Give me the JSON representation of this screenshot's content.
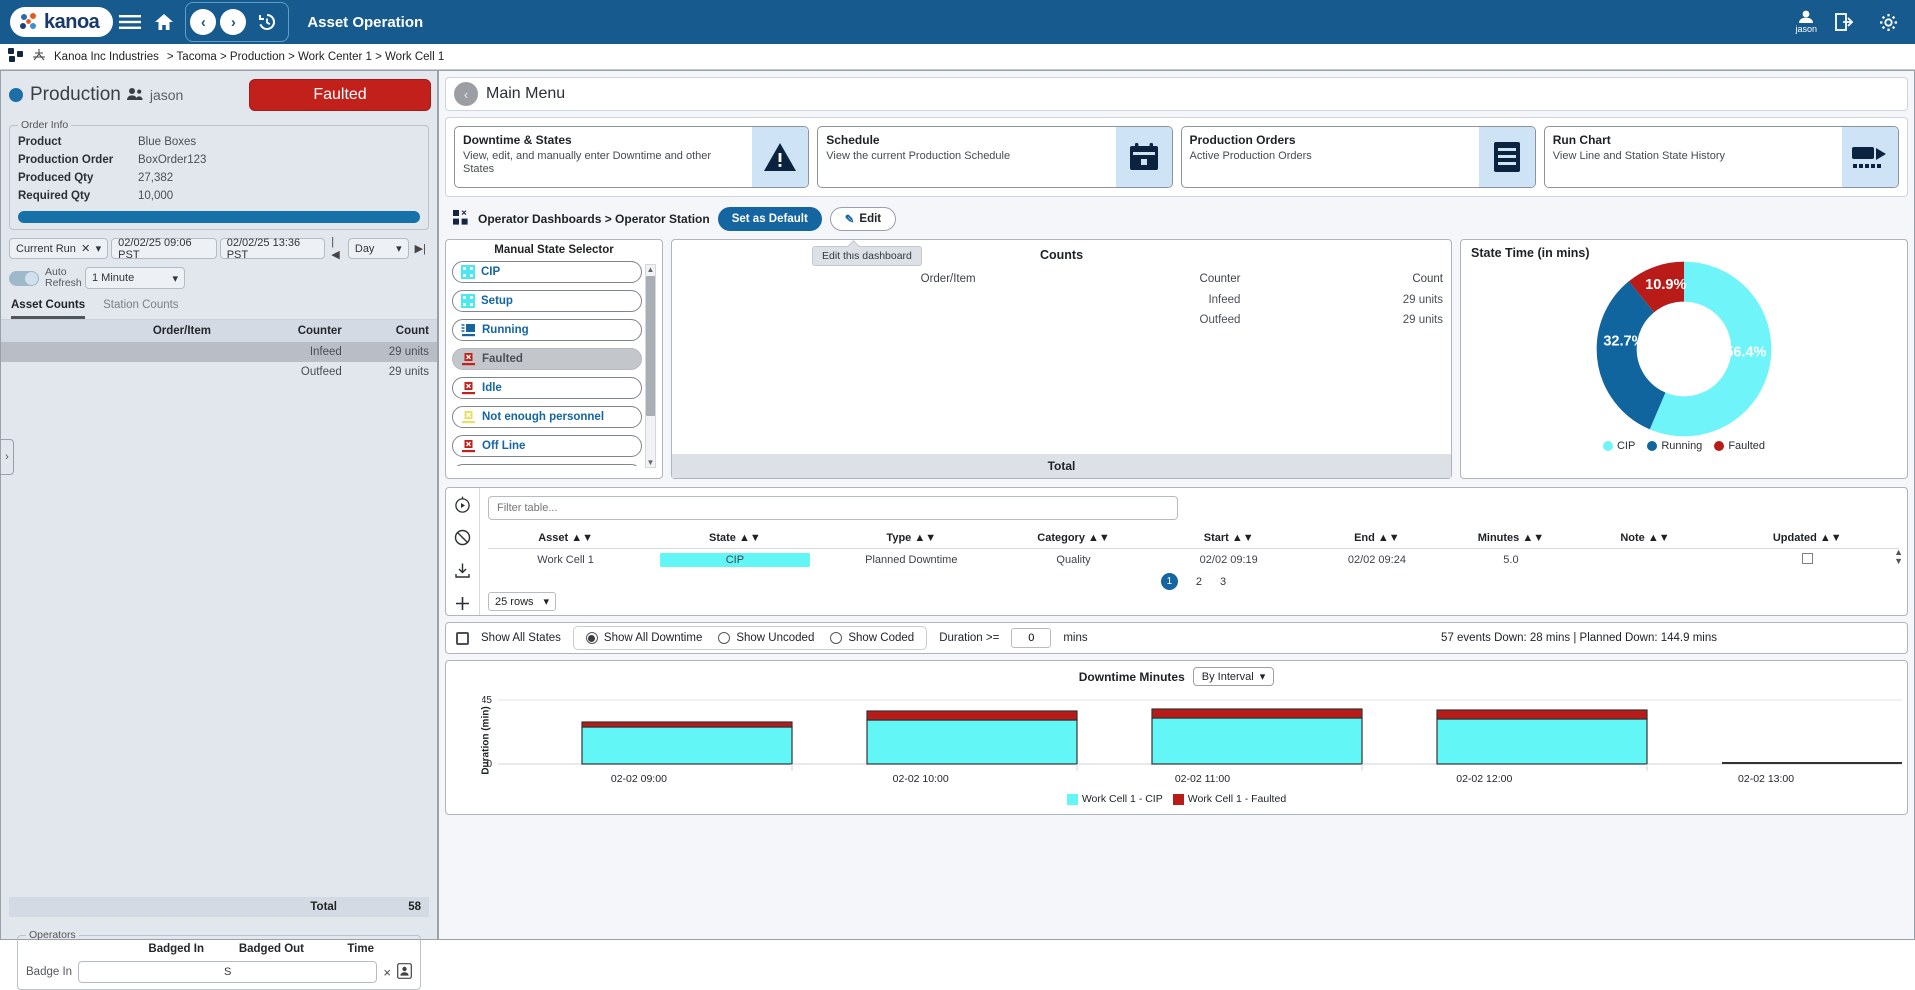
{
  "topbar": {
    "brand": "kanoa",
    "title": "Asset Operation",
    "menu_icon": "hamburger-icon",
    "home_icon": "home-icon",
    "back_icon": "‹",
    "forward_icon": "›",
    "history_icon": "history-icon",
    "user_label": "jason"
  },
  "breadcrumb": {
    "root": "Kanoa Inc Industries",
    "path": "> Tacoma > Production > Work Center 1 > Work Cell 1"
  },
  "left": {
    "header": {
      "title": "Production",
      "user": "jason",
      "status": "Faulted"
    },
    "order_info": {
      "legend": "Order Info",
      "rows": [
        {
          "key": "Product",
          "value": "Blue Boxes"
        },
        {
          "key": "Production Order",
          "value": "BoxOrder123"
        },
        {
          "key": "Produced Qty",
          "value": "27,382"
        },
        {
          "key": "Required Qty",
          "value": "10,000"
        }
      ],
      "progress_pct": 100
    },
    "controls": {
      "run_select": "Current Run",
      "start_time": "02/02/25 09:06 PST",
      "end_time": "02/02/25 13:36 PST",
      "prev_icon": "|◀",
      "interval": "Day",
      "next_icon": "▶|",
      "auto_refresh_label_1": "Auto",
      "auto_refresh_label_2": "Refresh",
      "refresh_interval": "1 Minute"
    },
    "tabs": [
      {
        "label": "Asset Counts",
        "active": true
      },
      {
        "label": "Station Counts",
        "active": false
      }
    ],
    "counts_table": {
      "headers": [
        "Order/Item",
        "Counter",
        "Count"
      ],
      "rows": [
        {
          "item": "",
          "counter": "Infeed",
          "count": "29 units",
          "highlight": true
        },
        {
          "item": "",
          "counter": "Outfeed",
          "count": "29 units",
          "highlight": false
        }
      ],
      "total_label": "Total",
      "total_value": "58"
    },
    "operators": {
      "legend": "Operators",
      "headers": [
        "Badged In",
        "Badged Out",
        "Time"
      ],
      "badge_in_label": "Badge In",
      "badge_in_value": "S",
      "clear_icon": "×",
      "card_icon": "badge-card-icon"
    },
    "collapse_handle": "›"
  },
  "right": {
    "main_menu": {
      "back_icon": "‹",
      "title": "Main Menu"
    },
    "cards": [
      {
        "title": "Downtime & States",
        "desc": "View, edit, and manually enter Downtime and other States",
        "icon": "warning-triangle-icon"
      },
      {
        "title": "Schedule",
        "desc": "View the current Production Schedule",
        "icon": "calendar-icon"
      },
      {
        "title": "Production Orders",
        "desc": "Active Production Orders",
        "icon": "document-lines-icon"
      },
      {
        "title": "Run Chart",
        "desc": "View Line and Station State History",
        "icon": "run-chart-icon"
      }
    ],
    "dashboard_bar": {
      "icon": "dashboard-grid-icon",
      "crumb": "Operator Dashboards > Operator Station",
      "set_default": "Set as Default",
      "edit": "Edit",
      "edit_icon": "pencil-icon"
    },
    "state_selector": {
      "title": "Manual State Selector",
      "items": [
        {
          "label": "CIP",
          "icon": "grid-icon",
          "color": "#4ae8ef",
          "selected": false
        },
        {
          "label": "Setup",
          "icon": "grid-icon",
          "color": "#4ae8ef",
          "selected": false
        },
        {
          "label": "Running",
          "icon": "machine-icon",
          "color": "#1565a0",
          "selected": false
        },
        {
          "label": "Faulted",
          "icon": "machine-fault-icon",
          "color": "#c1201b",
          "selected": true
        },
        {
          "label": "Idle",
          "icon": "machine-fault-icon",
          "color": "#c1201b",
          "selected": false
        },
        {
          "label": "Not enough personnel",
          "icon": "machine-fault-icon",
          "color": "#e5e06a",
          "selected": false
        },
        {
          "label": "Off Line",
          "icon": "machine-fault-icon",
          "color": "#c1201b",
          "selected": false
        }
      ],
      "scroll_up": "▲",
      "scroll_down": "▼"
    },
    "counts_panel": {
      "edit_tooltip": "Edit this dashboard",
      "title": "Counts",
      "headers": [
        "Order/Item",
        "Counter",
        "Count"
      ],
      "rows": [
        {
          "item": "",
          "counter": "Infeed",
          "count": "29 units"
        },
        {
          "item": "",
          "counter": "Outfeed",
          "count": "29 units"
        }
      ],
      "total_label": "Total"
    },
    "state_time": {
      "title": "State Time (in mins)"
    },
    "downtime_table": {
      "tools": [
        "play-circle-icon",
        "block-icon",
        "download-icon",
        "plus-icon"
      ],
      "filter_placeholder": "Filter table...",
      "headers": [
        "Asset",
        "State",
        "Type",
        "Category",
        "Start",
        "End",
        "Minutes",
        "Note",
        "Updated"
      ],
      "rows": [
        {
          "asset": "Work Cell 1",
          "state": "CIP",
          "type": "Planned Downtime",
          "category": "Quality",
          "start": "02/02 09:19",
          "end": "02/02 09:24",
          "minutes": "5.0",
          "note": "",
          "updated": false
        }
      ],
      "rows_per_page": "25 rows",
      "pages": [
        "1",
        "2",
        "3"
      ],
      "active_page": "1"
    },
    "filter_bar": {
      "show_all_states": "Show All States",
      "radios": [
        {
          "label": "Show All Downtime",
          "checked": true
        },
        {
          "label": "Show Uncoded",
          "checked": false
        },
        {
          "label": "Show Coded",
          "checked": false
        }
      ],
      "duration_label": "Duration >=",
      "duration_value": "0",
      "duration_unit": "mins",
      "summary": "57 events  Down: 28 mins | Planned Down: 144.9 mins"
    },
    "downtime_chart_header": {
      "title": "Downtime Minutes",
      "mode": "By Interval"
    }
  },
  "chart_data": [
    {
      "type": "pie",
      "title": "State Time (in mins)",
      "labels": [
        "CIP",
        "Running",
        "Faulted"
      ],
      "values": [
        56.4,
        32.7,
        10.9
      ],
      "value_labels": [
        "56.4%",
        "32.7%",
        "10.9%"
      ],
      "colors": [
        "#6ff4f9",
        "#11659e",
        "#b81b18"
      ],
      "legend_position": "bottom",
      "donut": true
    },
    {
      "type": "bar",
      "title": "Downtime Minutes",
      "stacked": true,
      "categories": [
        "02-02 09:00",
        "02-02 10:00",
        "02-02 11:00",
        "02-02 12:00",
        "02-02 13:00"
      ],
      "series": [
        {
          "name": "Work Cell 1 - CIP",
          "color": "#63f6f6",
          "values": [
            25,
            33,
            35,
            34,
            0
          ]
        },
        {
          "name": "Work Cell 1 - Faulted",
          "color": "#b81b18",
          "values": [
            2,
            4,
            4,
            4,
            0
          ]
        }
      ],
      "ylabel": "Duration (min)",
      "ylim": [
        0,
        45
      ],
      "yticks": [
        0,
        45
      ],
      "grid": true,
      "legend_position": "bottom"
    }
  ]
}
